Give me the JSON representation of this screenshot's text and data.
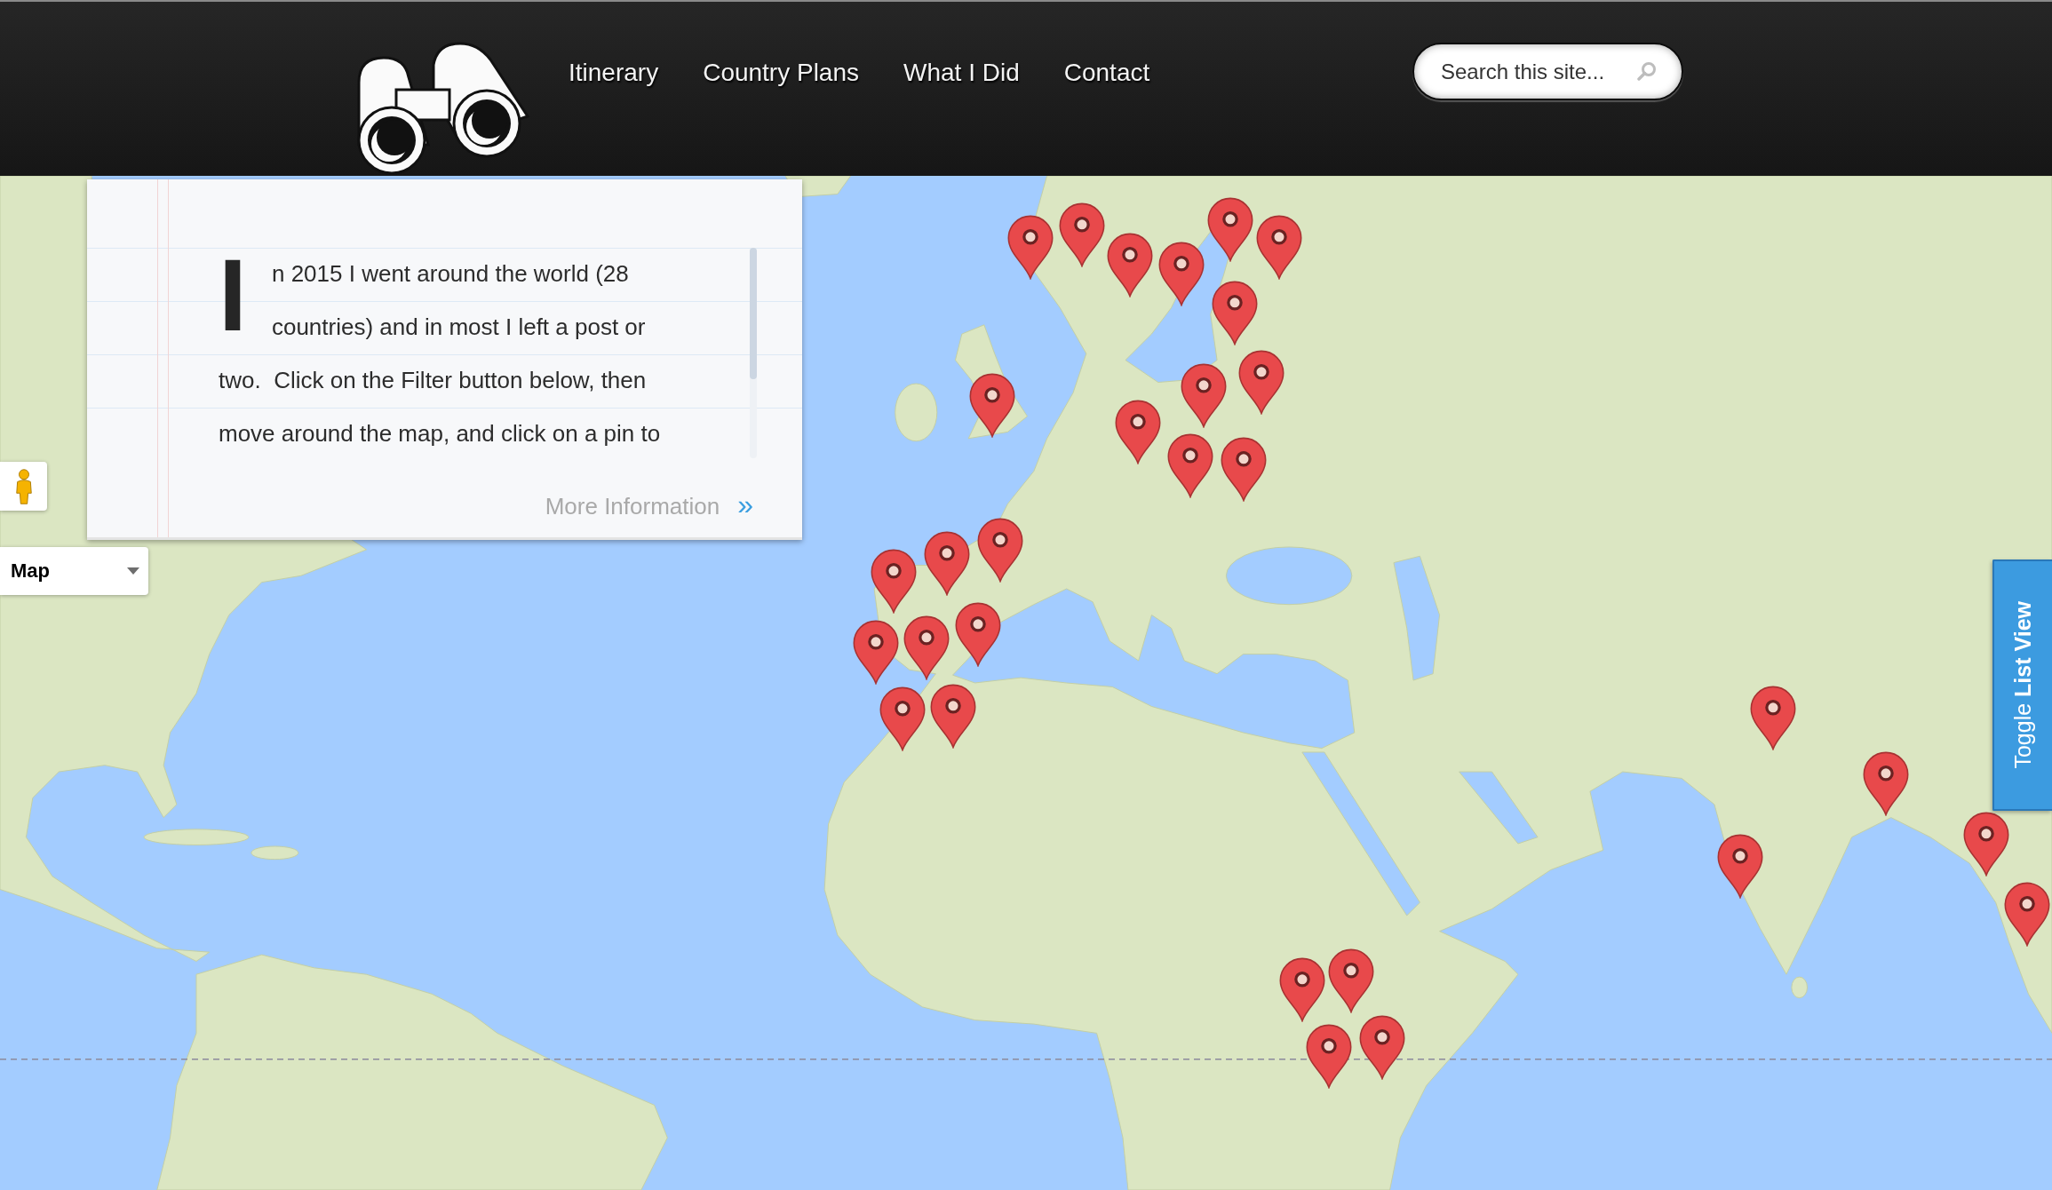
{
  "header": {
    "nav": [
      {
        "label": "Itinerary"
      },
      {
        "label": "Country Plans"
      },
      {
        "label": "What I Did"
      },
      {
        "label": "Contact"
      }
    ],
    "search": {
      "placeholder": "Search this site..."
    }
  },
  "intro_panel": {
    "text_lines": [
      "In 2015 I went around the world (28",
      "countries) and in most I left a post or",
      "two.  Click on the Filter button below, then",
      "move around the map, and click on a pin to"
    ],
    "more_link": {
      "label": "More Information",
      "arrow": "»"
    }
  },
  "map_controls": {
    "map_type": "Map"
  },
  "list_toggle": {
    "label": "Toggle **List View**"
  }
}
